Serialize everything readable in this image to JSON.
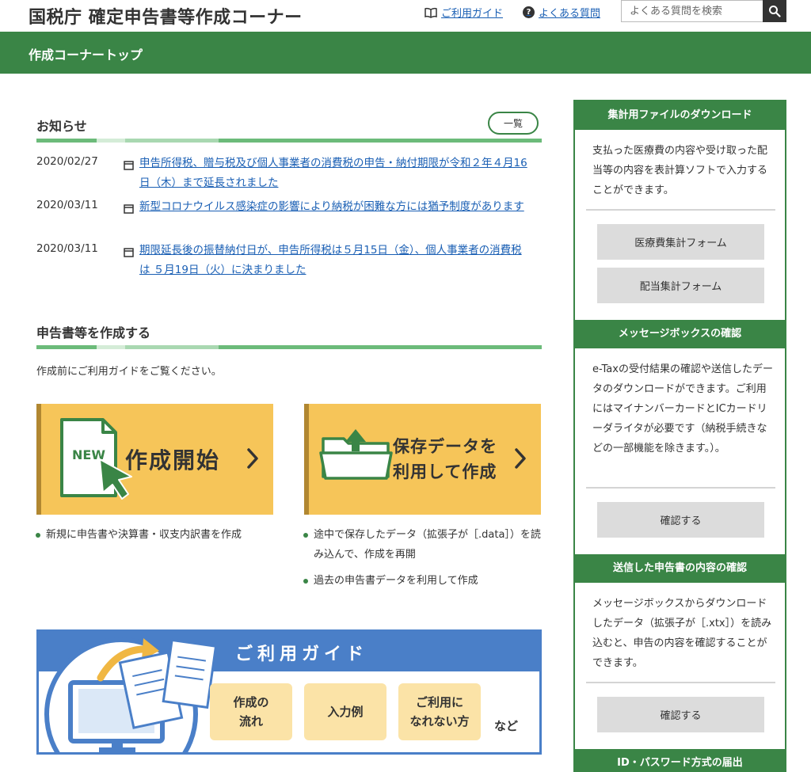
{
  "header": {
    "site_title": "国税庁 確定申告書等作成コーナー",
    "guide_link": "ご利用ガイド",
    "faq_link": "よくある質問",
    "faq_icon_glyph": "?",
    "search_placeholder": "よくある質問を検索"
  },
  "nav": {
    "title": "作成コーナートップ"
  },
  "news": {
    "title": "お知らせ",
    "list_button": "一覧",
    "items": [
      {
        "date": "2020/02/27",
        "text": "申告所得税、贈与税及び個人事業者の消費税の申告・納付期限が令和２年４月16日（木）まで延長されました"
      },
      {
        "date": "2020/03/11",
        "text": "新型コロナウイルス感染症の影響により納税が困難な方には猶予制度があります"
      },
      {
        "date": "2020/03/11",
        "text": "期限延長後の振替納付日が、申告所得税は５月15日（金）、個人事業者の消費税は ５月19日（火）に決まりました"
      }
    ]
  },
  "create": {
    "title": "申告書等を作成する",
    "intro": "作成前にご利用ガイドをご覧ください。",
    "start": {
      "badge": "NEW",
      "label": "作成開始",
      "bullets": [
        "新規に申告書や決算書・収支内訳書を作成"
      ]
    },
    "saved": {
      "label_line1": "保存データを",
      "label_line2": "利用して作成",
      "bullets": [
        "途中で保存したデータ（拡張子が［.data］）を読み込んで、作成を再開",
        "過去の申告書データを利用して作成"
      ]
    }
  },
  "guide_banner": {
    "title": "ご利用ガイド",
    "chip1_line1": "作成の",
    "chip1_line2": "流れ",
    "chip2": "入力例",
    "chip3_line1": "ご利用に",
    "chip3_line2": "なれない方",
    "suffix": "など"
  },
  "sidebar": {
    "download": {
      "title": "集計用ファイルのダウンロード",
      "text": "支払った医療費の内容や受け取った配当等の内容を表計算ソフトで入力することができます。",
      "button1": "医療費集計フォーム",
      "button2": "配当集計フォーム"
    },
    "messagebox": {
      "title": "メッセージボックスの確認",
      "text": "e-Taxの受付結果の確認や送信したデータのダウンロードができます。ご利用にはマイナンバーカードとICカードリーダライタが必要です（納税手続きなどの一部機能を除きます。）。",
      "button": "確認する"
    },
    "sent": {
      "title": "送信した申告書の内容の確認",
      "text": "メッセージボックスからダウンロードしたデータ（拡張子が［.xtx］）を読み込むと、申告の内容を確認することができます。",
      "button": "確認する"
    },
    "idpw": {
      "title": "ID・パスワード方式の届出"
    }
  },
  "colors": {
    "brand_green": "#3a8546",
    "button_yellow": "#f6c559",
    "guide_blue": "#4a7fc8",
    "link_blue": "#1a5fb4"
  },
  "icons": [
    "book-icon",
    "question-icon",
    "search-icon",
    "document-icon",
    "new-file-icon",
    "cursor-arrow-icon",
    "folder-upload-icon",
    "chevron-right-icon",
    "monitor-icon"
  ]
}
